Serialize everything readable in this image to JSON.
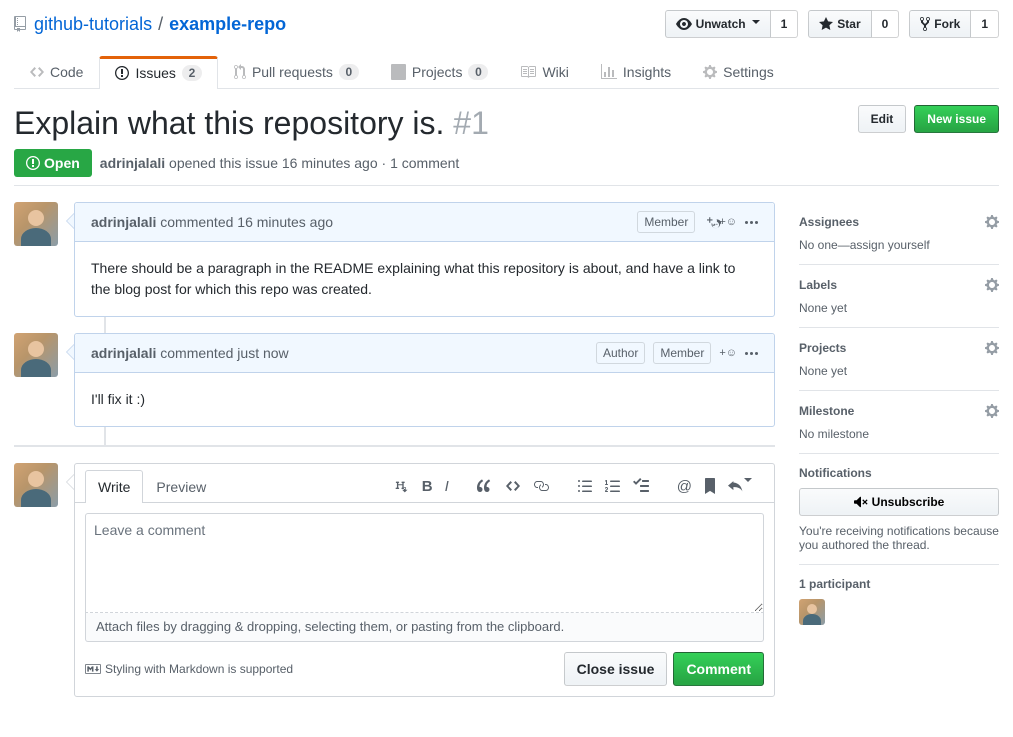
{
  "repo": {
    "owner": "github-tutorials",
    "name": "example-repo",
    "watch_label": "Unwatch",
    "watch_count": "1",
    "star_label": "Star",
    "star_count": "0",
    "fork_label": "Fork",
    "fork_count": "1"
  },
  "tabs": {
    "code": "Code",
    "issues": "Issues",
    "issues_count": "2",
    "pulls": "Pull requests",
    "pulls_count": "0",
    "projects": "Projects",
    "projects_count": "0",
    "wiki": "Wiki",
    "insights": "Insights",
    "settings": "Settings"
  },
  "issue": {
    "title": "Explain what this repository is.",
    "number": "#1",
    "edit_btn": "Edit",
    "new_issue_btn": "New issue",
    "state": "Open",
    "author": "adrinjalali",
    "opened_text": "opened this issue",
    "opened_time": "16 minutes ago",
    "comment_count_text": "1 comment"
  },
  "comments": [
    {
      "author": "adrinjalali",
      "action": "commented",
      "time": "16 minutes ago",
      "badges": [
        "Member"
      ],
      "body": "There should be a paragraph in the README explaining what this repository is about, and have a link to the blog post for which this repo was created."
    },
    {
      "author": "adrinjalali",
      "action": "commented",
      "time": "just now",
      "badges": [
        "Author",
        "Member"
      ],
      "body": "I'll fix it :)"
    }
  ],
  "form": {
    "write_tab": "Write",
    "preview_tab": "Preview",
    "placeholder": "Leave a comment",
    "drag_text": "Attach files by dragging & dropping, selecting them, or pasting from the clipboard.",
    "markdown_hint": "Styling with Markdown is supported",
    "close_btn": "Close issue",
    "comment_btn": "Comment"
  },
  "sidebar": {
    "assignees_title": "Assignees",
    "assignees_value": "No one—assign yourself",
    "labels_title": "Labels",
    "labels_value": "None yet",
    "projects_title": "Projects",
    "projects_value": "None yet",
    "milestone_title": "Milestone",
    "milestone_value": "No milestone",
    "notifications_title": "Notifications",
    "unsubscribe_btn": "Unsubscribe",
    "notifications_reason": "You're receiving notifications because you authored the thread.",
    "participants_title": "1 participant"
  }
}
